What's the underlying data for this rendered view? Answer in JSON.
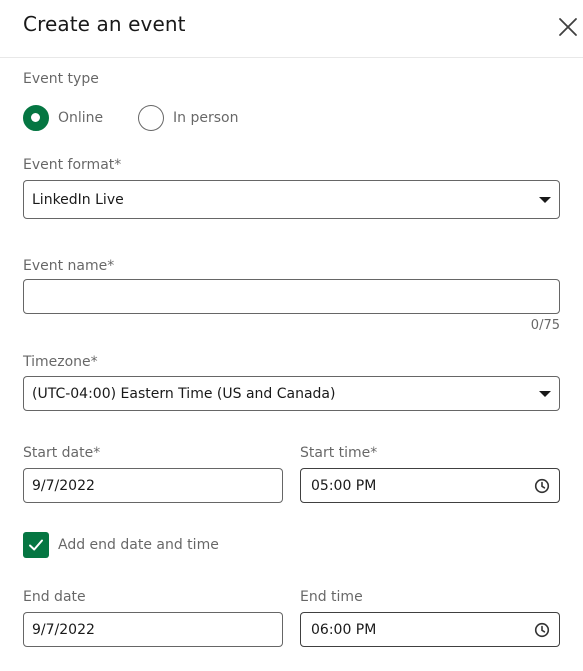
{
  "header": {
    "title": "Create an event",
    "close_icon": "close-icon"
  },
  "event_type": {
    "label": "Event type",
    "options": [
      {
        "label": "Online",
        "selected": true
      },
      {
        "label": "In person",
        "selected": false
      }
    ]
  },
  "event_format": {
    "label": "Event format*",
    "value": "LinkedIn Live"
  },
  "event_name": {
    "label": "Event name*",
    "value": "",
    "counter": "0/75"
  },
  "timezone": {
    "label": "Timezone*",
    "value": "(UTC-04:00) Eastern Time (US and Canada)"
  },
  "start": {
    "date_label": "Start date*",
    "date_value": "9/7/2022",
    "time_label": "Start time*",
    "time_value": "05:00 PM"
  },
  "end_toggle": {
    "label": "Add end date and time",
    "checked": true
  },
  "end": {
    "date_label": "End date",
    "date_value": "9/7/2022",
    "time_label": "End time",
    "time_value": "06:00 PM"
  },
  "colors": {
    "accent": "#057642",
    "text_secondary": "#666666",
    "border": "#666666"
  }
}
